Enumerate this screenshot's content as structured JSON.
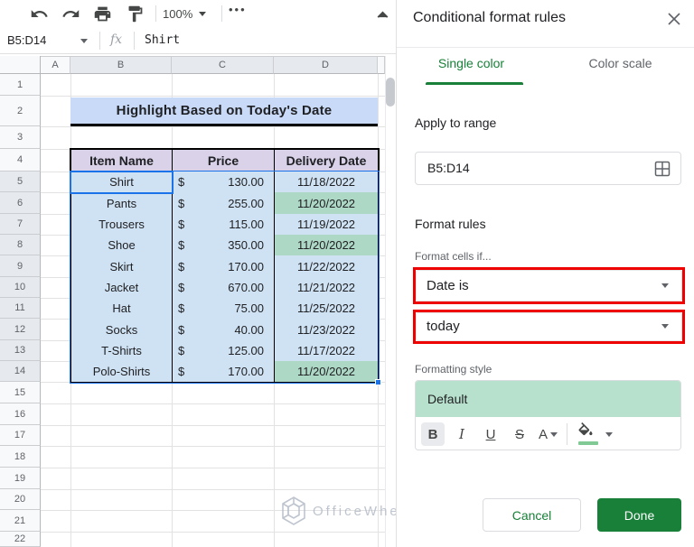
{
  "colors": {
    "accent_green": "#188038",
    "annotation_red": "#ee0000",
    "selection_blue": "#1a73e8",
    "cell_blue": "#cfe2f3",
    "highlight_green": "#aed8c6",
    "table_header_purple": "#d9d2e9",
    "title_banner_blue": "#c9daf8",
    "style_preview_green": "#b7e1cd"
  },
  "toolbar": {
    "zoom_value": "100%",
    "more_glyph": "•••",
    "icons": [
      "undo-icon",
      "redo-icon",
      "print-icon",
      "paint-format-icon",
      "more-icon",
      "collapse-toolbar-icon"
    ]
  },
  "formula_bar": {
    "name_box_value": "B5:D14",
    "fx_label": "fx",
    "cell_content": "Shirt"
  },
  "sheet": {
    "col_headers": [
      "A",
      "B",
      "C",
      "D"
    ],
    "row_numbers": [
      1,
      2,
      3,
      4,
      5,
      6,
      7,
      8,
      9,
      10,
      11,
      12,
      13,
      14,
      15,
      16,
      17,
      18,
      19,
      20,
      21,
      22
    ],
    "selected_range": {
      "cols": [
        "B",
        "C",
        "D"
      ],
      "row_start": 5,
      "row_end": 14,
      "active_cell": "B5"
    },
    "title": "Highlight Based on Today's Date",
    "table": {
      "headers": [
        "Item Name",
        "Price",
        "Delivery Date"
      ],
      "rows": [
        {
          "item": "Shirt",
          "currency": "$",
          "price": "130.00",
          "date": "11/18/2022",
          "highlight": false
        },
        {
          "item": "Pants",
          "currency": "$",
          "price": "255.00",
          "date": "11/20/2022",
          "highlight": true
        },
        {
          "item": "Trousers",
          "currency": "$",
          "price": "115.00",
          "date": "11/19/2022",
          "highlight": false
        },
        {
          "item": "Shoe",
          "currency": "$",
          "price": "350.00",
          "date": "11/20/2022",
          "highlight": true
        },
        {
          "item": "Skirt",
          "currency": "$",
          "price": "170.00",
          "date": "11/22/2022",
          "highlight": false
        },
        {
          "item": "Jacket",
          "currency": "$",
          "price": "670.00",
          "date": "11/21/2022",
          "highlight": false
        },
        {
          "item": "Hat",
          "currency": "$",
          "price": "75.00",
          "date": "11/25/2022",
          "highlight": false
        },
        {
          "item": "Socks",
          "currency": "$",
          "price": "40.00",
          "date": "11/23/2022",
          "highlight": false
        },
        {
          "item": "T-Shirts",
          "currency": "$",
          "price": "125.00",
          "date": "11/17/2022",
          "highlight": false
        },
        {
          "item": "Polo-Shirts",
          "currency": "$",
          "price": "170.00",
          "date": "11/20/2022",
          "highlight": true
        }
      ]
    },
    "watermark": "OfficeWheel"
  },
  "panel": {
    "title": "Conditional format rules",
    "tabs": [
      {
        "label": "Single color",
        "active": true
      },
      {
        "label": "Color scale",
        "active": false
      }
    ],
    "apply_to_range": {
      "label": "Apply to range",
      "value": "B5:D14"
    },
    "format_rules": {
      "heading": "Format rules",
      "condition_label": "Format cells if...",
      "condition_value": "Date is",
      "condition_param": "today"
    },
    "formatting_style": {
      "label": "Formatting style",
      "preview_text": "Default",
      "bold_label": "B",
      "italic_label": "I",
      "underline_label": "U",
      "strike_label": "S",
      "text_color_label": "A"
    },
    "cancel_label": "Cancel",
    "done_label": "Done"
  }
}
